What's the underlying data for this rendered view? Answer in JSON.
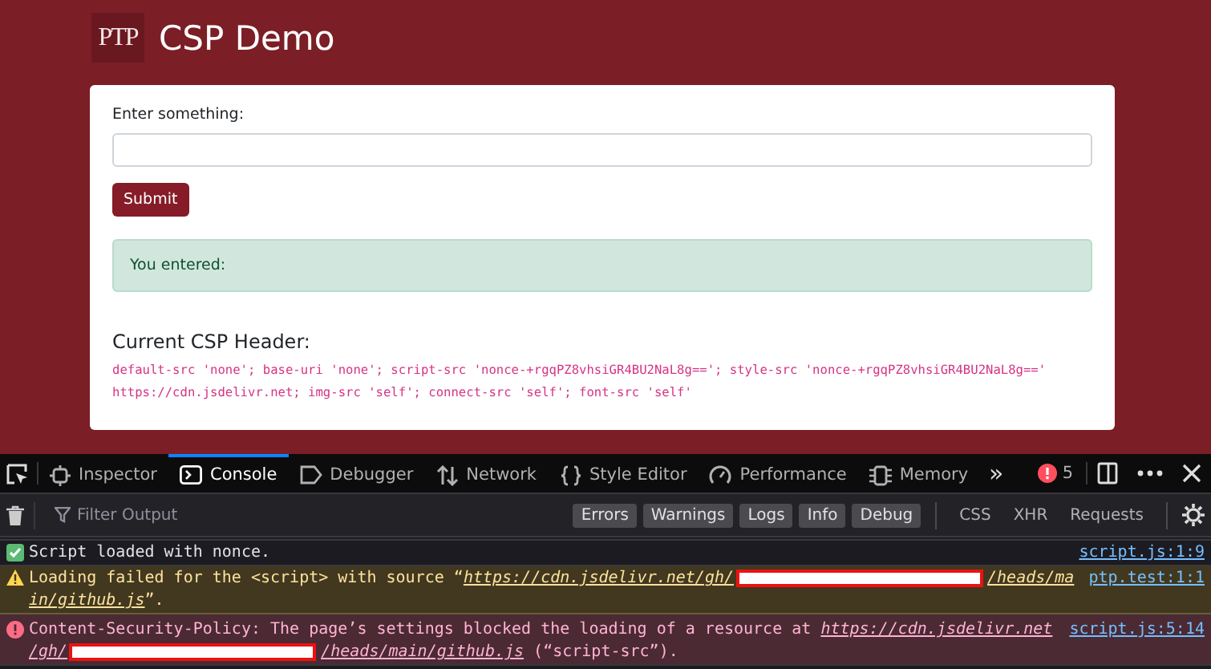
{
  "page": {
    "logo": "PTP",
    "title": "CSP Demo",
    "form": {
      "label": "Enter something:",
      "submit": "Submit",
      "result": "You entered:"
    },
    "csp": {
      "heading": "Current CSP Header:",
      "value": "default-src 'none'; base-uri 'none'; script-src 'nonce-+rgqPZ8vhsiGR4BU2NaL8g=='; style-src 'nonce-+rgqPZ8vhsiGR4BU2NaL8g==' https://cdn.jsdelivr.net; img-src 'self'; connect-src 'self'; font-src 'self'"
    }
  },
  "devtools": {
    "tabs": [
      {
        "label": "Inspector",
        "selected": false
      },
      {
        "label": "Console",
        "selected": true
      },
      {
        "label": "Debugger",
        "selected": false
      },
      {
        "label": "Network",
        "selected": false
      },
      {
        "label": "Style Editor",
        "selected": false
      },
      {
        "label": "Performance",
        "selected": false
      },
      {
        "label": "Memory",
        "selected": false
      }
    ],
    "overflow": "»",
    "error_count": "5",
    "filter": {
      "placeholder": "Filter Output"
    },
    "levels": [
      {
        "label": "Errors",
        "selected": true
      },
      {
        "label": "Warnings",
        "selected": true
      },
      {
        "label": "Logs",
        "selected": true
      },
      {
        "label": "Info",
        "selected": true
      },
      {
        "label": "Debug",
        "selected": true
      }
    ],
    "types": [
      {
        "label": "CSS",
        "selected": false
      },
      {
        "label": "XHR",
        "selected": false
      },
      {
        "label": "Requests",
        "selected": false
      }
    ],
    "messages": [
      {
        "kind": "log",
        "lines": [
          [
            {
              "kind": "text",
              "text": "Script loaded with nonce."
            }
          ]
        ],
        "source": "script.js:1:9"
      },
      {
        "kind": "warning",
        "lines": [
          [
            {
              "kind": "text",
              "text": "Loading failed for the <script> with source “"
            },
            {
              "kind": "link",
              "text": "https://cdn.jsdelivr.net/gh/"
            },
            {
              "kind": "redacted"
            },
            {
              "kind": "link",
              "text": "/heads/ma"
            }
          ],
          [
            {
              "kind": "link",
              "text": "in/github.js"
            },
            {
              "kind": "text",
              "text": "”."
            }
          ]
        ],
        "source": "ptp.test:1:1"
      },
      {
        "kind": "error",
        "lines": [
          [
            {
              "kind": "text",
              "text": "Content-Security-Policy: The page’s settings blocked the loading of a resource at "
            },
            {
              "kind": "link",
              "text": "https://cdn.jsdelivr.net"
            }
          ],
          [
            {
              "kind": "link",
              "text": "/gh/"
            },
            {
              "kind": "redacted"
            },
            {
              "kind": "link",
              "text": "/heads/main/github.js"
            },
            {
              "kind": "text",
              "text": " (“script-src”)."
            }
          ]
        ],
        "source": "script.js:5:14"
      }
    ]
  }
}
